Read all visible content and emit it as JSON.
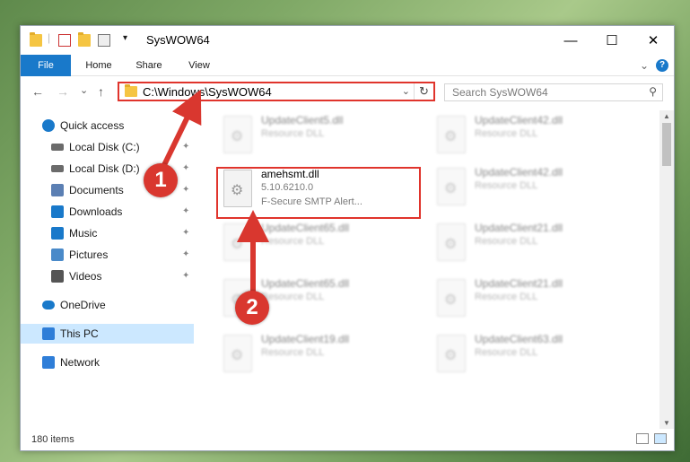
{
  "window": {
    "title": "SysWOW64",
    "minimize": "—",
    "maximize": "☐",
    "close": "✕"
  },
  "ribbon": {
    "tabs": [
      "File",
      "Home",
      "Share",
      "View"
    ],
    "collapse": "⌄",
    "help": "?"
  },
  "nav": {
    "back": "←",
    "forward": "→",
    "recent": "⌄",
    "up": "↑",
    "address": "C:\\Windows\\SysWOW64",
    "refresh": "↻",
    "dropdown": "⌄",
    "search_placeholder": "Search SysWOW64",
    "search_icon": "⚲"
  },
  "sidebar": {
    "items": [
      {
        "label": "Quick access",
        "icon": "star-icon",
        "color": "#1979ca",
        "pinned": false
      },
      {
        "label": "Local Disk (C:)",
        "icon": "drive-icon",
        "color": "#6b6b6b",
        "pinned": true
      },
      {
        "label": "Local Disk (D:)",
        "icon": "drive-icon",
        "color": "#6b6b6b",
        "pinned": true
      },
      {
        "label": "Documents",
        "icon": "documents-icon",
        "color": "#5b7fb3",
        "pinned": true
      },
      {
        "label": "Downloads",
        "icon": "downloads-icon",
        "color": "#1979ca",
        "pinned": true
      },
      {
        "label": "Music",
        "icon": "music-icon",
        "color": "#1979ca",
        "pinned": true
      },
      {
        "label": "Pictures",
        "icon": "pictures-icon",
        "color": "#4a8ac9",
        "pinned": true
      },
      {
        "label": "Videos",
        "icon": "videos-icon",
        "color": "#555555",
        "pinned": true
      },
      {
        "label": "OneDrive",
        "icon": "cloud-icon",
        "color": "#1979ca",
        "pinned": false
      },
      {
        "label": "This PC",
        "icon": "computer-icon",
        "color": "#2f7ed8",
        "pinned": false,
        "selected": true
      },
      {
        "label": "Network",
        "icon": "network-icon",
        "color": "#2f7ed8",
        "pinned": false
      }
    ],
    "pin_glyph": "📌"
  },
  "files": {
    "highlighted": {
      "name": "amehsmt.dll",
      "version": "5.10.6210.0",
      "description": "F-Secure SMTP Alert..."
    },
    "background": [
      {
        "name": "UpdateClient5.dll",
        "sub": "Resource DLL"
      },
      {
        "name": "UpdateClient42.dll",
        "sub": "Resource DLL"
      },
      {
        "name": "UpdateClient42.dll",
        "sub": "Resource DLL"
      },
      {
        "name": "UpdateClient65.dll",
        "sub": "Resource DLL"
      },
      {
        "name": "UpdateClient21.dll",
        "sub": "Resource DLL"
      },
      {
        "name": "UpdateClient65.dll",
        "sub": "Resource DLL"
      },
      {
        "name": "UpdateClient21.dll",
        "sub": "Resource DLL"
      },
      {
        "name": "UpdateClient19.dll",
        "sub": "Resource DLL"
      },
      {
        "name": "UpdateClient63.dll",
        "sub": "Resource DLL"
      }
    ]
  },
  "status": {
    "items": "180 items"
  },
  "annotations": {
    "step1": "1",
    "step2": "2",
    "color": "#d9372f"
  }
}
